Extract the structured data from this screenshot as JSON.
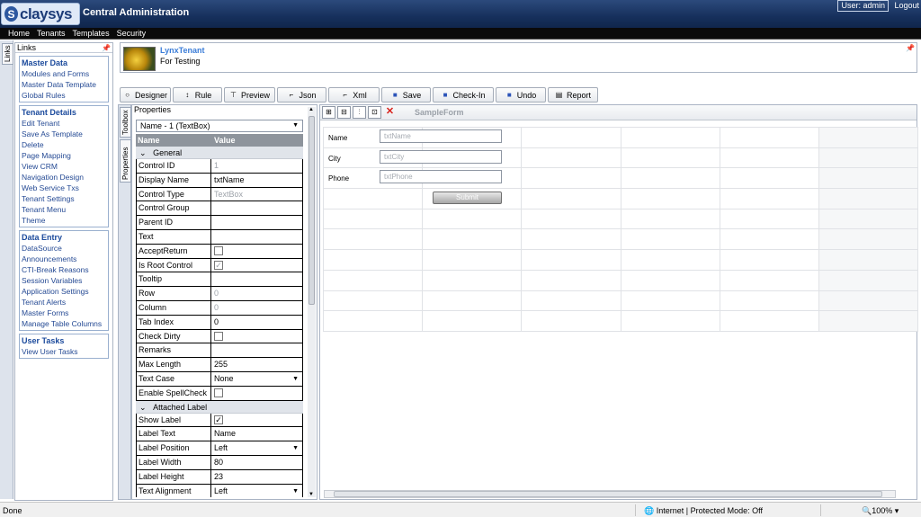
{
  "header": {
    "logo_text": "claysys",
    "title": "Central Administration",
    "user": "User: admin",
    "logout": "Logout"
  },
  "nav": [
    "Home",
    "Tenants",
    "Templates",
    "Security"
  ],
  "left_strip": {
    "links_tab": "Links"
  },
  "links": {
    "title": "Links",
    "groups": [
      {
        "title": "Master Data",
        "items": [
          "Modules and Forms",
          "Master Data Template",
          "Global Rules"
        ]
      },
      {
        "title": "Tenant Details",
        "items": [
          "Edit Tenant",
          "Save As Template",
          "Delete",
          "Page Mapping",
          "View CRM",
          "Navigation Design",
          "Web Service Txs",
          "Tenant Settings",
          "Tenant Menu",
          "Theme"
        ]
      },
      {
        "title": "Data Entry",
        "items": [
          "DataSource",
          "Announcements",
          "CTI-Break Reasons",
          "Session Variables",
          "Application Settings",
          "Tenant Alerts",
          "Master Forms",
          "Manage Table Columns"
        ]
      },
      {
        "title": "User Tasks",
        "items": [
          "View User Tasks"
        ]
      }
    ]
  },
  "tenant": {
    "name": "LynxTenant",
    "description": "For Testing"
  },
  "toolbar": [
    "Designer",
    "Rule",
    "Preview",
    "Json",
    "Xml",
    "Save",
    "Check-In",
    "Undo",
    "Report"
  ],
  "side_tabs": {
    "toolbox": "Toolbox",
    "properties": "Properties"
  },
  "properties": {
    "title": "Properties",
    "selected": "Name - 1 (TextBox)",
    "col_name": "Name",
    "col_value": "Value",
    "cat_general": "General",
    "cat_label": "Attached Label",
    "general": [
      {
        "name": "Control ID",
        "value": "1",
        "gray": true
      },
      {
        "name": "Display Name",
        "value": "txtName"
      },
      {
        "name": "Control Type",
        "value": "TextBox",
        "gray": true
      },
      {
        "name": "Control Group",
        "value": ""
      },
      {
        "name": "Parent ID",
        "value": ""
      },
      {
        "name": "Text",
        "value": ""
      },
      {
        "name": "AcceptReturn",
        "value": "",
        "checkbox": true
      },
      {
        "name": "Is Root Control",
        "value": "✓",
        "checkbox": true,
        "gray": true
      },
      {
        "name": "Tooltip",
        "value": ""
      },
      {
        "name": "Row",
        "value": "0",
        "gray": true
      },
      {
        "name": "Column",
        "value": "0",
        "gray": true
      },
      {
        "name": "Tab Index",
        "value": "0"
      },
      {
        "name": "Check Dirty",
        "value": "",
        "checkbox": true
      },
      {
        "name": "Remarks",
        "value": ""
      },
      {
        "name": "Max Length",
        "value": "255"
      },
      {
        "name": "Text Case",
        "value": "None",
        "dropdown": true
      },
      {
        "name": "Enable SpellCheck",
        "value": "",
        "checkbox": true
      }
    ],
    "label": [
      {
        "name": "Show Label",
        "value": "✓",
        "checkbox": true
      },
      {
        "name": "Label Text",
        "value": "Name"
      },
      {
        "name": "Label Position",
        "value": "Left",
        "dropdown": true
      },
      {
        "name": "Label Width",
        "value": "80"
      },
      {
        "name": "Label Height",
        "value": "23"
      },
      {
        "name": "Text Alignment",
        "value": "Left",
        "dropdown": true
      }
    ]
  },
  "designer": {
    "form_name": "SampleForm",
    "fields": [
      {
        "label": "Name",
        "placeholder": "txtName"
      },
      {
        "label": "City",
        "placeholder": "txtCity"
      },
      {
        "label": "Phone",
        "placeholder": "txtPhone"
      }
    ],
    "submit": "Submit"
  },
  "status": {
    "left": "Done",
    "zone": "Internet | Protected Mode: Off",
    "zoom": "100%"
  }
}
